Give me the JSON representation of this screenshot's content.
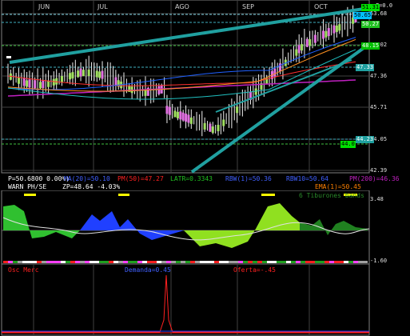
{
  "months": [
    "JUN",
    "JUL",
    "AGO",
    "SEP",
    "OCT"
  ],
  "corner_label": "F=0.0",
  "price_axis": [
    "53.68",
    "49.02",
    "47.36",
    "45.71",
    "44.05",
    "42.39"
  ],
  "price_boxes": [
    {
      "text": "51.31",
      "bg": "#00e000",
      "fg": "#000000"
    },
    {
      "text": "50.65",
      "bg": "#00bfff",
      "fg": "#000000"
    },
    {
      "text": "50.27",
      "bg": "#20c020",
      "fg": "#ffffff"
    },
    {
      "text": "48.15",
      "bg": "#00c000",
      "fg": "#ffffff"
    },
    {
      "text": "47.33",
      "bg": "#20a0a0",
      "fg": "#ffffff"
    },
    {
      "text": "44.23",
      "bg": "#20a0a0",
      "fg": "#ffffff"
    },
    {
      "text": "44.0",
      "bg": "#00e000",
      "fg": "#000000"
    }
  ],
  "info_row1": [
    {
      "text": "P=50.6800  0.00%)",
      "color": "#ffffff"
    },
    {
      "text": "MA(20)=50.10",
      "color": "#4060ff"
    },
    {
      "text": "PM(50)=47.27",
      "color": "#ff2020"
    },
    {
      "text": "LATR=0.3343",
      "color": "#20c020"
    },
    {
      "text": "RBW(1)=50.36",
      "color": "#4060ff"
    },
    {
      "text": "RBW10=50.64",
      "color": "#4060ff"
    },
    {
      "text": "PM(200)=46.36",
      "color": "#c020c0"
    }
  ],
  "info_row2": [
    {
      "text": "WARN PH/SE",
      "color": "#ffffff"
    },
    {
      "text": "ZP=48.64  -4.03%",
      "color": "#ffffff"
    },
    {
      "text": "EMA(1)=50.45",
      "color": "#ff8000"
    }
  ],
  "indicator_label": "6 Tiburones bands",
  "indicator_axis_top": "3.48",
  "indicator_axis_bottom": "-1.60",
  "osc_labels": [
    {
      "text": "Osc Merc",
      "color": "#ff2020"
    },
    {
      "text": "Demanda=0.45",
      "color": "#4060ff"
    },
    {
      "text": "Oferta=-.45",
      "color": "#ff2020"
    }
  ]
}
